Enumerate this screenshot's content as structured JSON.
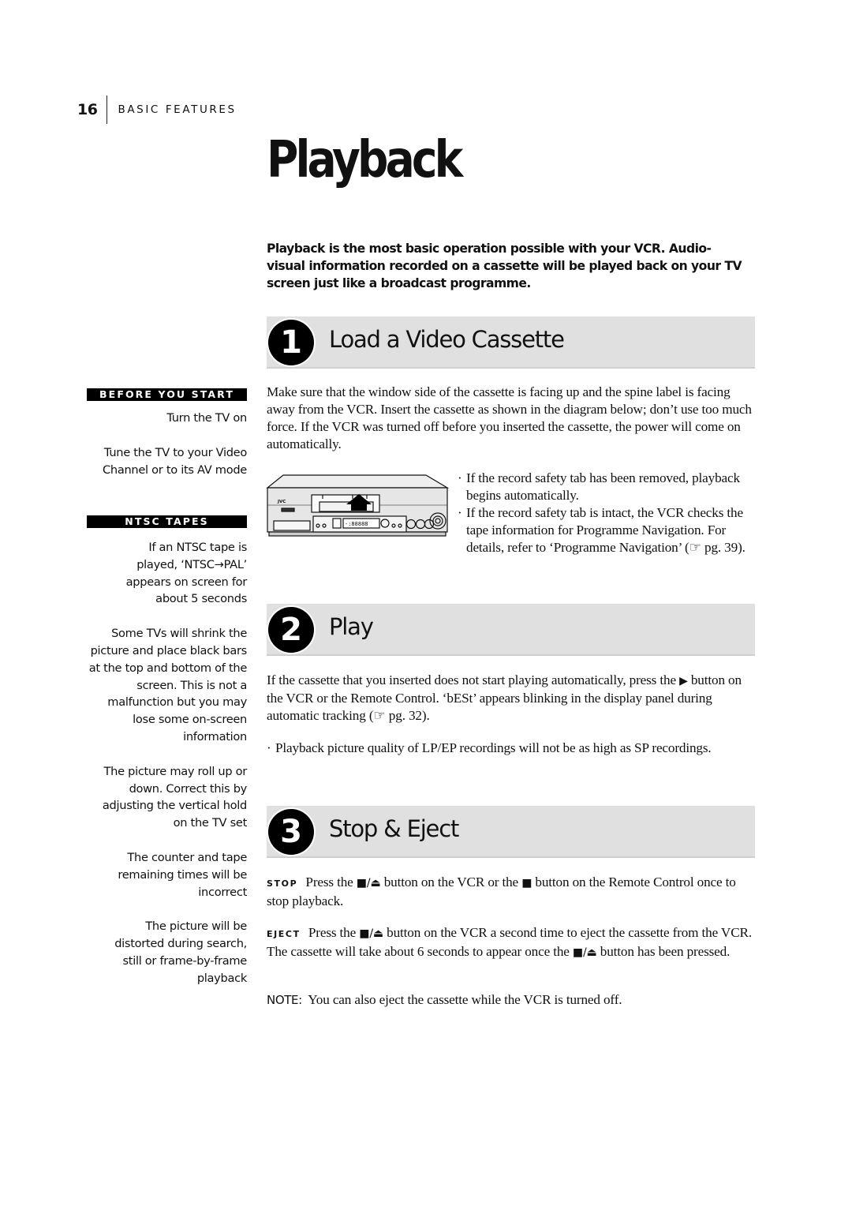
{
  "header": {
    "page_number": "16",
    "section": "BASIC FEATURES"
  },
  "title": "Playback",
  "intro": "Playback is the most basic operation possible with your VCR. Audio-visual information recorded on a cassette will be played back on your TV screen just like a broadcast programme.",
  "sidebar": {
    "before_you_start": {
      "heading": "BEFORE YOU START",
      "items": [
        "Turn the TV on",
        "Tune the TV to your Video Channel or to its AV mode"
      ]
    },
    "ntsc_tapes": {
      "heading": "NTSC TAPES",
      "items": [
        "If an NTSC tape is played, ‘NTSC→PAL’ appears on screen for about 5 seconds",
        "Some TVs will shrink the picture and place black bars at the top and bottom of the screen. This is not a malfunction but you may lose some on-screen information",
        "The picture may roll up or down. Correct this by adjusting the vertical hold on the TV set",
        "The counter and tape remaining times will be incorrect",
        "The picture will be distorted during search, still or frame-by-frame playback"
      ]
    }
  },
  "steps": [
    {
      "number": "1",
      "title": "Load a Video Cassette",
      "body": "Make sure that the window side of the cassette is facing up and the spine label is facing away from the VCR. Insert the cassette as shown in the diagram below; don’t use too much force. If the VCR was turned off before you inserted the cassette, the power will come on automatically.",
      "bullets": [
        "If the record safety tab has been removed, playback begins automatically.",
        "If the record safety tab is intact, the VCR checks the tape information for Programme Navigation. For details, refer to ‘Programme Navigation’ (☞ pg. 39)."
      ],
      "figure": {
        "brand": "JVC",
        "display": "-:88888",
        "icon": "vcr-illustration"
      }
    },
    {
      "number": "2",
      "title": "Play",
      "body_before_icon": "If the cassette that you inserted does not start playing automatically, press the",
      "play_icon": "▶",
      "body_after_icon": "button on the VCR or the Remote Control. ‘bESt’ appears blinking in the display panel during automatic tracking (☞ pg. 32).",
      "bullets": [
        "Playback picture quality of LP/EP recordings will not be as high as SP recordings."
      ]
    },
    {
      "number": "3",
      "title": "Stop & Eject",
      "stop": {
        "label": "STOP",
        "t1": "Press the",
        "icon1": "■/⏏",
        "t2": "button on the VCR or the",
        "icon2": "■",
        "t3": "button on the Remote Control once to stop playback."
      },
      "eject": {
        "label": "EJECT",
        "t1": "Press the",
        "icon1": "■/⏏",
        "t2": "button on the VCR a second time to eject the cassette from the VCR. The cassette will take about 6 seconds to appear once the",
        "icon2": "■/⏏",
        "t3": "button has been pressed."
      },
      "note": {
        "label": "NOTE:",
        "text": "You can also eject the cassette while the VCR is turned off."
      }
    }
  ]
}
